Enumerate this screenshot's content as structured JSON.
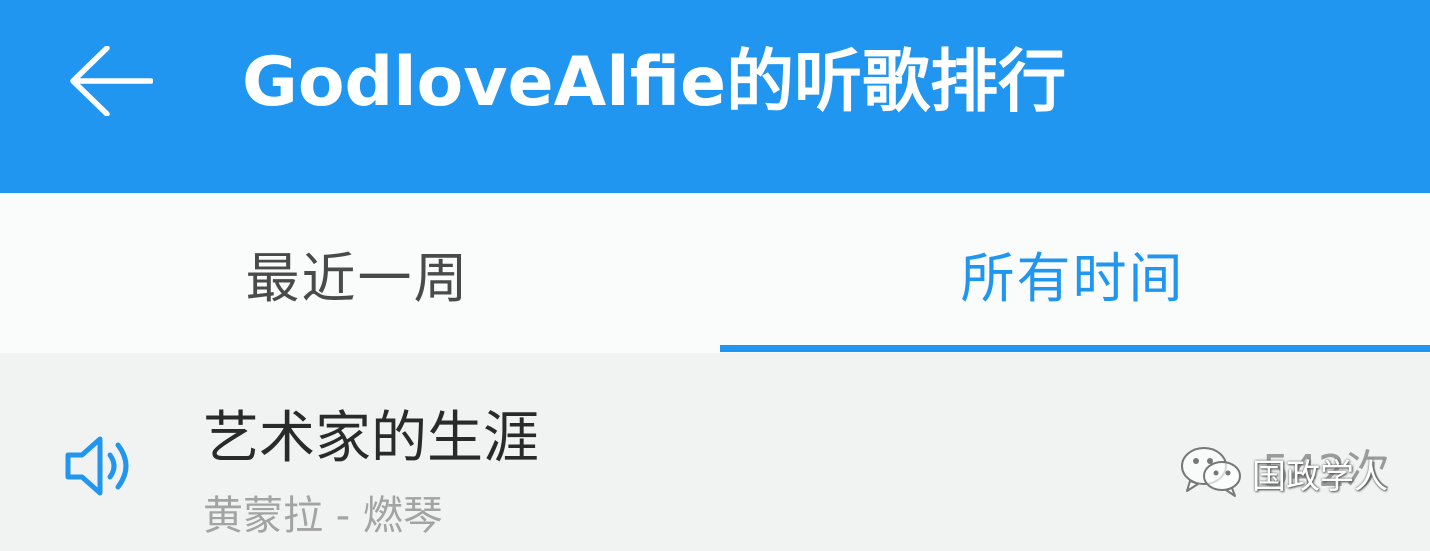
{
  "header": {
    "title": "GodloveAlfie的听歌排行",
    "back_icon": "arrow-left-icon",
    "background_color": "#2196f0"
  },
  "tabs": [
    {
      "label": "最近一周",
      "selected": false
    },
    {
      "label": "所有时间",
      "selected": true
    }
  ],
  "accent_color": "#2196f0",
  "list": {
    "items": [
      {
        "title": "艺术家的生涯",
        "subtitle": "黄蒙拉 - 燃琴",
        "play_count": "542次",
        "icon": "speaker-playing-icon",
        "count_icon": "play-circle-icon"
      }
    ]
  },
  "watermark": {
    "text": "国政学人",
    "icon": "wechat-icon"
  }
}
